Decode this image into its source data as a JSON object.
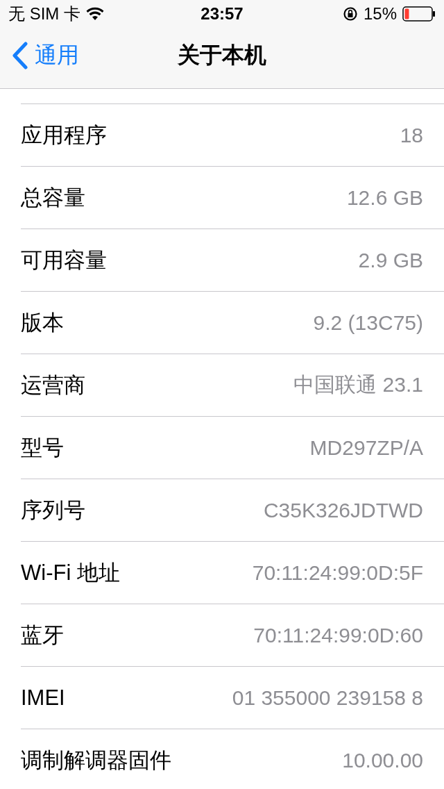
{
  "status_bar": {
    "carrier": "无 SIM 卡",
    "time": "23:57",
    "battery": "15%"
  },
  "nav": {
    "back": "通用",
    "title": "关于本机"
  },
  "rows": [
    {
      "label": "应用程序",
      "value": "18"
    },
    {
      "label": "总容量",
      "value": "12.6 GB"
    },
    {
      "label": "可用容量",
      "value": "2.9 GB"
    },
    {
      "label": "版本",
      "value": "9.2 (13C75)"
    },
    {
      "label": "运营商",
      "value": "中国联通 23.1"
    },
    {
      "label": "型号",
      "value": "MD297ZP/A"
    },
    {
      "label": "序列号",
      "value": "C35K326JDTWD"
    },
    {
      "label": "Wi-Fi 地址",
      "value": "70:11:24:99:0D:5F"
    },
    {
      "label": "蓝牙",
      "value": "70:11:24:99:0D:60"
    },
    {
      "label": "IMEI",
      "value": "01 355000 239158 8"
    },
    {
      "label": "调制解调器固件",
      "value": "10.00.00"
    }
  ]
}
